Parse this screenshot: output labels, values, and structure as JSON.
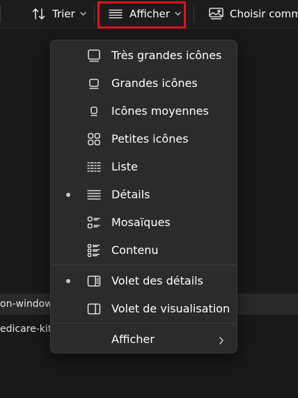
{
  "toolbar": {
    "sort_label": "Trier",
    "view_label": "Afficher",
    "choose_label": "Choisir comme"
  },
  "files": [
    {
      "name": "on-window",
      "selected": true
    },
    {
      "name": "edicare-kit.p",
      "selected": false
    }
  ],
  "menu": {
    "items": [
      {
        "label": "Très grandes icônes",
        "icon": "extra-large-icons-icon",
        "checked": false
      },
      {
        "label": "Grandes icônes",
        "icon": "large-icons-icon",
        "checked": false
      },
      {
        "label": "Icônes moyennes",
        "icon": "medium-icons-icon",
        "checked": false
      },
      {
        "label": "Petites icônes",
        "icon": "small-icons-icon",
        "checked": false
      },
      {
        "label": "Liste",
        "icon": "list-icon",
        "checked": false
      },
      {
        "label": "Détails",
        "icon": "details-icon",
        "checked": true
      },
      {
        "label": "Mosaïques",
        "icon": "tiles-icon",
        "checked": false
      },
      {
        "label": "Contenu",
        "icon": "content-icon",
        "checked": false
      }
    ],
    "panes": [
      {
        "label": "Volet des détails",
        "icon": "details-pane-icon",
        "checked": true
      },
      {
        "label": "Volet de visualisation",
        "icon": "preview-pane-icon",
        "checked": false
      }
    ],
    "submenu": {
      "label": "Afficher",
      "icon": "chevron-right-icon"
    }
  },
  "colors": {
    "background": "#191919",
    "menu_background": "#2b2b2b",
    "highlight_border": "#e0141a",
    "text": "#ffffff"
  }
}
